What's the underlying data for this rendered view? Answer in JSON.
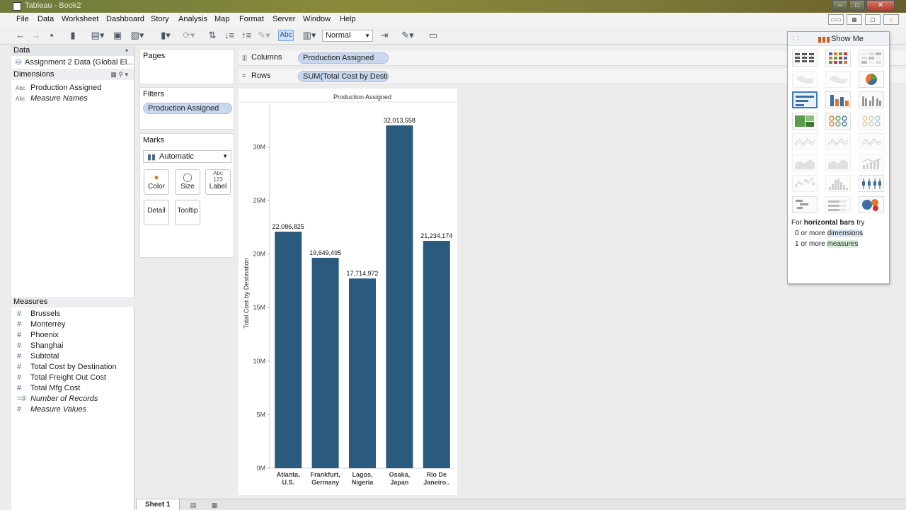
{
  "window": {
    "title": "Tableau - Book2"
  },
  "menu": [
    "File",
    "Data",
    "Worksheet",
    "Dashboard",
    "Story",
    "Analysis",
    "Map",
    "Format",
    "Server",
    "Window",
    "Help"
  ],
  "toolbar": {
    "fit_value": "Normal",
    "abc_label": "Abc"
  },
  "data_pane": {
    "header": "Data",
    "datasource": "Assignment 2 Data (Global El...",
    "dimensions_header": "Dimensions",
    "dimensions": [
      {
        "type": "Abc",
        "name": "Production Assigned",
        "italic": false
      },
      {
        "type": "Abc",
        "name": "Measure Names",
        "italic": true
      }
    ],
    "measures_header": "Measures",
    "measures": [
      {
        "name": "Brussels",
        "italic": false
      },
      {
        "name": "Monterrey",
        "italic": false
      },
      {
        "name": "Phoenix",
        "italic": false
      },
      {
        "name": "Shanghai",
        "italic": false
      },
      {
        "name": "Subtotal",
        "italic": false
      },
      {
        "name": "Total Cost by Destination",
        "italic": false
      },
      {
        "name": "Total Freight Out Cost",
        "italic": false
      },
      {
        "name": "Total Mfg Cost",
        "italic": false
      },
      {
        "name": "Number of Records",
        "italic": true
      },
      {
        "name": "Measure Values",
        "italic": true
      }
    ]
  },
  "pages": {
    "title": "Pages"
  },
  "filters": {
    "title": "Filters",
    "items": [
      "Production Assigned"
    ]
  },
  "marks": {
    "title": "Marks",
    "type": "Automatic",
    "buttons": [
      "Color",
      "Size",
      "Label",
      "Detail",
      "Tooltip"
    ]
  },
  "shelves": {
    "columns_label": "Columns",
    "columns_pill": "Production Assigned",
    "rows_label": "Rows",
    "rows_pill": "SUM(Total Cost by Desti.."
  },
  "show_me": {
    "title": "Show Me",
    "hint_prefix": "For ",
    "hint_bold": "horizontal bars",
    "hint_suffix": " try",
    "hint_line2_prefix": "0 or more ",
    "hint_line2_highlight": "dimensions",
    "hint_line3_prefix": "1 or more ",
    "hint_line3_highlight": "measures"
  },
  "sheet_tabs": [
    "Sheet 1"
  ],
  "colors": {
    "bar": "#2a5a7e",
    "pill": "#c9d8ee",
    "accent": "#3a7bc8"
  },
  "chart_data": {
    "type": "bar",
    "title": "Production Assigned",
    "ylabel": "Total Cost by Destination",
    "xlabel": "",
    "categories": [
      "Atlanta, U.S.",
      "Frankfurt, Germany",
      "Lagos, Nigeria",
      "Osaka, Japan",
      "Rio De Janeiro.."
    ],
    "category_lines": [
      [
        "Atlanta,",
        "U.S."
      ],
      [
        "Frankfurt,",
        "Germany"
      ],
      [
        "Lagos,",
        "Nigeria"
      ],
      [
        "Osaka,",
        "Japan"
      ],
      [
        "Rio De",
        "Janeiro.."
      ]
    ],
    "values": [
      22086825,
      19649495,
      17714972,
      32013558,
      21234174
    ],
    "labels": [
      "22,086,825",
      "19,649,495",
      "17,714,972",
      "32,013,558",
      "21,234,174"
    ],
    "ylim": [
      0,
      34000000
    ],
    "yticks": [
      0,
      5000000,
      10000000,
      15000000,
      20000000,
      25000000,
      30000000
    ],
    "ytick_labels": [
      "0M",
      "5M",
      "10M",
      "15M",
      "20M",
      "25M",
      "30M"
    ],
    "grid": false
  }
}
